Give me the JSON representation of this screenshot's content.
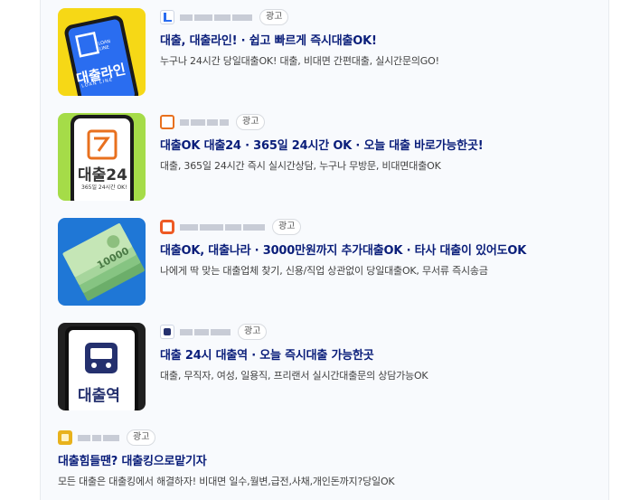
{
  "ads": [
    {
      "badge": "광고",
      "title": "대출, 대출라인! · 쉽고 빠르게 즉시대출OK!",
      "desc": "누구나 24시간 당일대출OK! 대출, 비대면 간편대출, 실시간문의GO!",
      "thumb_text": "대출라인",
      "thumb_sub": "LOAN LINE",
      "color": "#f4d21c"
    },
    {
      "badge": "광고",
      "title": "대출OK 대출24 · 365일 24시간 OK · 오늘 대출 바로가능한곳!",
      "desc": "대출, 365일 24시간 즉시 실시간상담, 누구나 무방문, 비대면대출OK",
      "thumb_text": "대출24",
      "thumb_sub": "365일 24시간 OK!",
      "color": "#e8701e"
    },
    {
      "badge": "광고",
      "title": "대출OK, 대출나라 · 3000만원까지 추가대출OK · 타사 대출이 있어도OK",
      "desc": "나에게 딱 맞는 대출업체 찾기, 신용/직업 상관없이 당일대출OK, 무서류 즉시송금",
      "thumb_text": "10000",
      "color": "#1f77d6"
    },
    {
      "badge": "광고",
      "title": "대출 24시 대출역 · 오늘 즉시대출 가능한곳",
      "desc": "대출, 무직자, 여성, 일용직, 프리랜서 실시간대출문의 상담가능OK",
      "thumb_text": "대출역",
      "color": "#24306e"
    },
    {
      "badge": "광고",
      "title": "대출힘들땐? 대출킹으로맡기자",
      "desc": "모든 대출은 대출킹에서 해결하자! 비대면 일수,월변,급전,사채,개인돈까지?당일OK",
      "color": "#e8b21c"
    }
  ]
}
